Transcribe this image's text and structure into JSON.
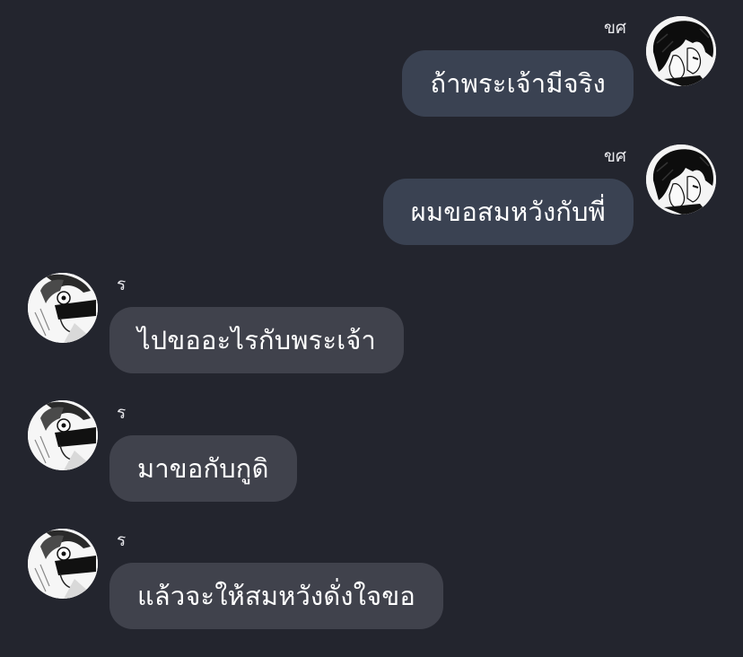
{
  "messages": [
    {
      "direction": "outgoing",
      "sender": "ขศ",
      "text": "ถ้าพระเจ้ามีจริง",
      "avatar_icon": "avatar-dark-hair-manga"
    },
    {
      "direction": "outgoing",
      "sender": "ขศ",
      "text": "ผมขอสมหวังกับพี่",
      "avatar_icon": "avatar-dark-hair-manga"
    },
    {
      "direction": "incoming",
      "sender": "ร",
      "text": "ไปขออะไรกับพระเจ้า",
      "avatar_icon": "avatar-manga-face"
    },
    {
      "direction": "incoming",
      "sender": "ร",
      "text": "มาขอกับกูดิ",
      "avatar_icon": "avatar-manga-face"
    },
    {
      "direction": "incoming",
      "sender": "ร",
      "text": "แล้วจะให้สมหวังดั่งใจขอ",
      "avatar_icon": "avatar-manga-face"
    }
  ],
  "colors": {
    "background": "#23252e",
    "outgoing_bubble": "#3a4252",
    "incoming_bubble": "#40424c",
    "text": "#ffffff"
  }
}
